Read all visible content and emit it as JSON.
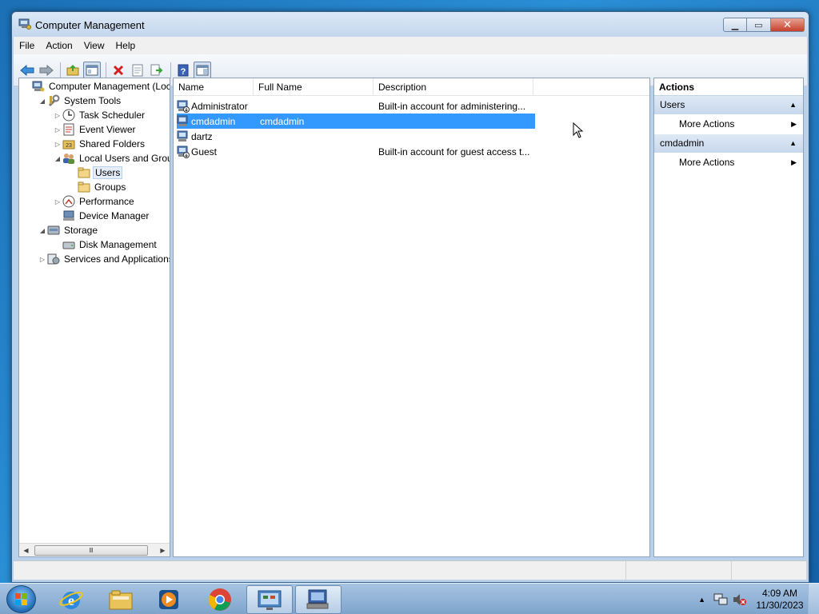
{
  "window": {
    "title": "Computer Management"
  },
  "menu": [
    "File",
    "Action",
    "View",
    "Help"
  ],
  "tree": [
    {
      "label": "Computer Management (Local",
      "indent": 0,
      "exp": "",
      "icon": "computer-management-icon"
    },
    {
      "label": "System Tools",
      "indent": 1,
      "exp": "◢",
      "icon": "system-tools-icon"
    },
    {
      "label": "Task Scheduler",
      "indent": 2,
      "exp": "▷",
      "icon": "task-scheduler-icon"
    },
    {
      "label": "Event Viewer",
      "indent": 2,
      "exp": "▷",
      "icon": "event-viewer-icon"
    },
    {
      "label": "Shared Folders",
      "indent": 2,
      "exp": "▷",
      "icon": "shared-folders-icon"
    },
    {
      "label": "Local Users and Groups",
      "indent": 2,
      "exp": "◢",
      "icon": "users-groups-icon"
    },
    {
      "label": "Users",
      "indent": 3,
      "exp": "",
      "icon": "folder-icon",
      "selected": true
    },
    {
      "label": "Groups",
      "indent": 3,
      "exp": "",
      "icon": "folder-icon"
    },
    {
      "label": "Performance",
      "indent": 2,
      "exp": "▷",
      "icon": "performance-icon"
    },
    {
      "label": "Device Manager",
      "indent": 2,
      "exp": "",
      "icon": "device-manager-icon"
    },
    {
      "label": "Storage",
      "indent": 1,
      "exp": "◢",
      "icon": "storage-icon"
    },
    {
      "label": "Disk Management",
      "indent": 2,
      "exp": "",
      "icon": "disk-management-icon"
    },
    {
      "label": "Services and Applications",
      "indent": 1,
      "exp": "▷",
      "icon": "services-icon"
    }
  ],
  "list": {
    "columns": [
      "Name",
      "Full Name",
      "Description"
    ],
    "rows": [
      {
        "name": "Administrator",
        "full_name": "",
        "description": "Built-in account for administering...",
        "disabled": true
      },
      {
        "name": "cmdadmin",
        "full_name": "cmdadmin",
        "description": "",
        "selected": true
      },
      {
        "name": "dartz",
        "full_name": "",
        "description": ""
      },
      {
        "name": "Guest",
        "full_name": "",
        "description": "Built-in account for guest access t...",
        "disabled": true
      }
    ]
  },
  "actions": {
    "title": "Actions",
    "groups": [
      {
        "label": "Users",
        "items": [
          "More Actions"
        ]
      },
      {
        "label": "cmdadmin",
        "items": [
          "More Actions"
        ]
      }
    ]
  },
  "taskbar": {
    "apps": [
      "start-button",
      "internet-explorer-icon",
      "file-explorer-icon",
      "media-player-icon",
      "chrome-icon",
      "control-panel-icon",
      "computer-management-icon"
    ],
    "time": "4:09 AM",
    "date": "11/30/2023"
  }
}
